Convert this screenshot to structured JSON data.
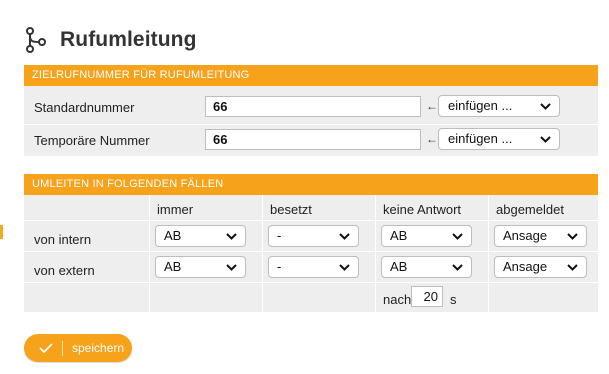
{
  "page": {
    "title": "Rufumleitung"
  },
  "target": {
    "heading": "ZIELRUFNUMMER FÜR RUFUMLEITUNG",
    "rows": [
      {
        "label": "Standardnummer",
        "value": "66",
        "arrow": "←",
        "select": "einfügen ..."
      },
      {
        "label": "Temporäre Nummer",
        "value": "66",
        "arrow": "←",
        "select": "einfügen ..."
      }
    ]
  },
  "cases": {
    "heading": "UMLEITEN IN FOLGENDEN FÄLLEN",
    "columns": [
      "immer",
      "besetzt",
      "keine Antwort",
      "abgemeldet"
    ],
    "rows": [
      {
        "label": "von intern",
        "values": [
          "AB",
          "-",
          "AB",
          "Ansage"
        ]
      },
      {
        "label": "von extern",
        "values": [
          "AB",
          "-",
          "AB",
          "Ansage"
        ]
      }
    ],
    "timeout": {
      "prefix": "nach",
      "value": "20",
      "unit": "s"
    }
  },
  "actions": {
    "save_label": "speichern"
  },
  "colors": {
    "accent": "#f6a21b",
    "panel_bg": "#eeeeee"
  }
}
